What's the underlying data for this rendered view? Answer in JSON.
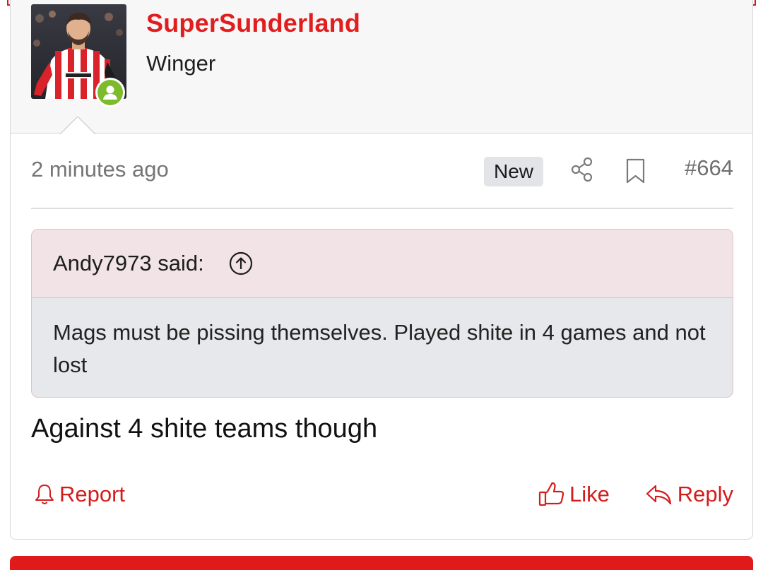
{
  "colors": {
    "accent": "#e11d1d",
    "action_red": "#d41c1c",
    "online_green": "#7dbb2c",
    "quote_header_bg": "#f2e4e6",
    "quote_body_bg": "#e6e8eb",
    "badge_bg": "#e2e4e7"
  },
  "post": {
    "author": {
      "username": "SuperSunderland",
      "title": "Winger",
      "avatar_icon": "avatar-photo",
      "status_icon": "online-user-icon"
    },
    "meta": {
      "timestamp": "2 minutes ago",
      "badge": "New",
      "share_icon": "share-icon",
      "bookmark_icon": "bookmark-icon",
      "post_number": "#664"
    },
    "quote": {
      "author_line": "Andy7973 said:",
      "jump_icon": "arrow-up-circle-icon",
      "text": "Mags must be pissing themselves. Played shite in 4 games and not lost"
    },
    "body": "Against 4 shite teams though",
    "actions": {
      "report": "Report",
      "like": "Like",
      "reply": "Reply"
    }
  }
}
